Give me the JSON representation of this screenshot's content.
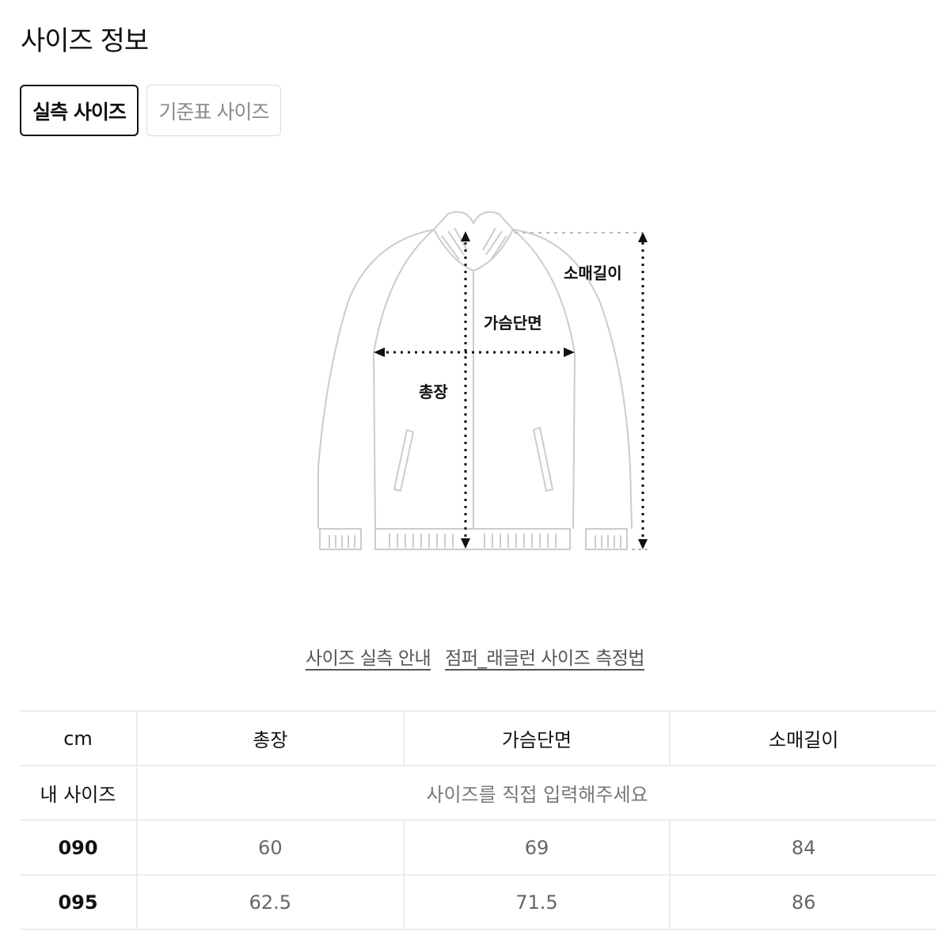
{
  "page": {
    "title": "사이즈 정보"
  },
  "tabs": [
    {
      "label": "실측 사이즈",
      "active": true
    },
    {
      "label": "기준표 사이즈",
      "active": false
    }
  ],
  "diagram": {
    "labels": {
      "sleeve_length": "소매길이",
      "chest_width": "가슴단면",
      "total_length": "총장"
    }
  },
  "links": {
    "guide": "사이즈 실측 안내",
    "method": "점퍼_래글런 사이즈 측정법"
  },
  "table": {
    "unit": "cm",
    "headers": [
      "총장",
      "가슴단면",
      "소매길이"
    ],
    "my_size": {
      "label": "내 사이즈",
      "placeholder": "사이즈를 직접 입력해주세요"
    },
    "rows": [
      {
        "size": "090",
        "values": [
          "60",
          "69",
          "84"
        ]
      },
      {
        "size": "095",
        "values": [
          "62.5",
          "71.5",
          "86"
        ]
      }
    ]
  },
  "colors": {
    "text": "#111111",
    "muted": "#8a8a8a",
    "border": "#ececec",
    "garment_line": "#cccccc"
  }
}
